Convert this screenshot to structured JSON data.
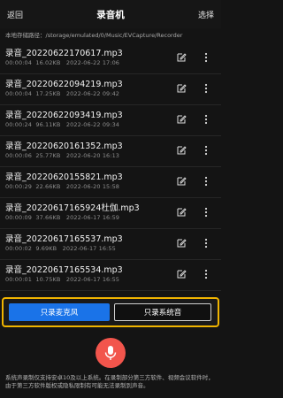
{
  "header": {
    "back_label": "返回",
    "title": "录音机",
    "select_label": "选择"
  },
  "storage_path": "本地存储路径：/storage/emulated/0/Music/EVCapture/Recorder",
  "recordings": [
    {
      "name": "录音_20220622170617.mp3",
      "duration": "00:00:04",
      "size": "16.02KB",
      "date": "2022-06-22 17:06"
    },
    {
      "name": "录音_20220622094219.mp3",
      "duration": "00:00:04",
      "size": "17.25KB",
      "date": "2022-06-22 09:42"
    },
    {
      "name": "录音_20220622093419.mp3",
      "duration": "00:00:24",
      "size": "96.11KB",
      "date": "2022-06-22 09:34"
    },
    {
      "name": "录音_20220620161352.mp3",
      "duration": "00:00:06",
      "size": "25.77KB",
      "date": "2022-06-20 16:13"
    },
    {
      "name": "录音_20220620155821.mp3",
      "duration": "00:00:29",
      "size": "22.66KB",
      "date": "2022-06-20 15:58"
    },
    {
      "name": "录音_20220617165924杜伽.mp3",
      "duration": "00:00:09",
      "size": "37.66KB",
      "date": "2022-06-17 16:59"
    },
    {
      "name": "录音_20220617165537.mp3",
      "duration": "00:00:02",
      "size": "9.69KB",
      "date": "2022-06-17 16:55"
    },
    {
      "name": "录音_20220617165534.mp3",
      "duration": "00:00:01",
      "size": "10.75KB",
      "date": "2022-06-17 16:55"
    }
  ],
  "tabs": {
    "mic_label": "只录麦克风",
    "system_label": "只录系统音"
  },
  "note": "系统声录制仅支持安卓10及以上系统。在录制部分第三方软件、视频会议软件时，由于第三方软件版权或隐私限制有可能无法录制到声音。",
  "icons": {
    "edit": "edit-icon",
    "more": "more-icon",
    "mic": "microphone-icon"
  },
  "colors": {
    "accent": "#1a73e8",
    "record": "#f2554c",
    "highlight": "#f0b400"
  }
}
